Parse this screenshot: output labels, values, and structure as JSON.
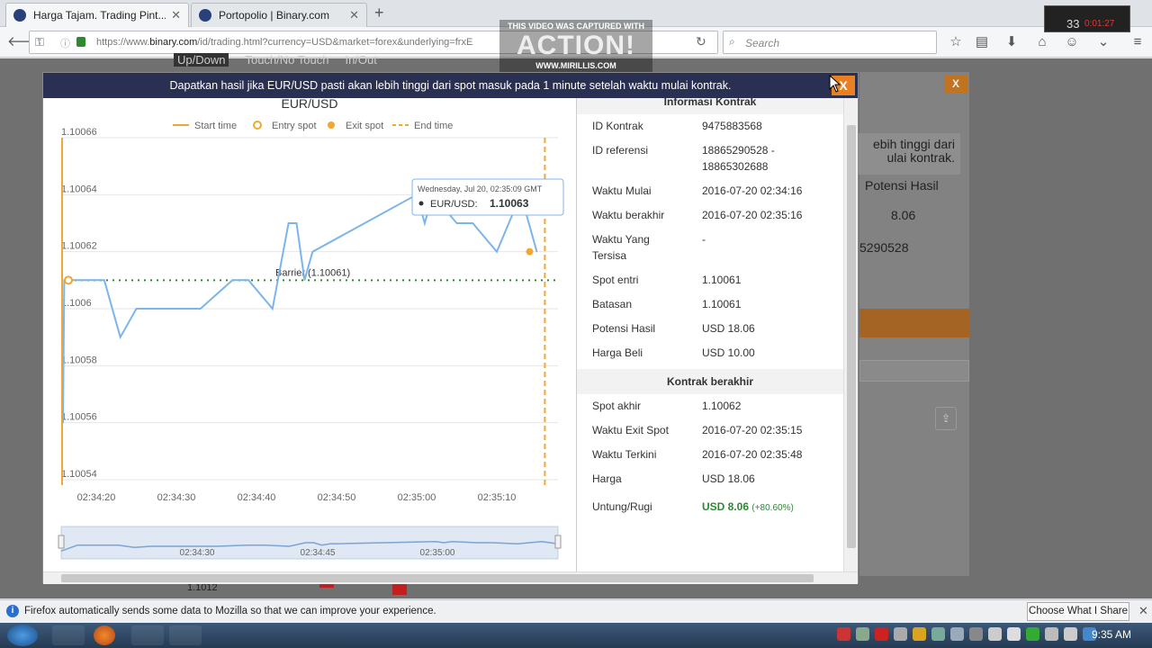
{
  "browser": {
    "tabs": [
      {
        "title": "Harga Tajam. Trading Pint...",
        "active": true
      },
      {
        "title": "Portopolio | Binary.com",
        "active": false
      }
    ],
    "url_prefix": "https://www.",
    "url_domain": "binary.com",
    "url_rest": "/id/trading.html?currency=USD&market=forex&underlying=frxE",
    "search_placeholder": "Search"
  },
  "watermark": {
    "line1": "THIS VIDEO WAS CAPTURED WITH",
    "line2": "ACTION!",
    "line3": "WWW.MIRILLIS.COM"
  },
  "recorder": {
    "value": "33",
    "time": "0:01:27"
  },
  "modal": {
    "header": "Dapatkan hasil jika EUR/USD pasti akan lebih tinggi dari spot masuk pada 1 minute setelah waktu mulai kontrak.",
    "close_label": "X",
    "info_title": "Informasi Kontrak",
    "rows": [
      {
        "k": "ID Kontrak",
        "v": "9475883568"
      },
      {
        "k": "ID referensi",
        "v": "18865290528 -\n18865302688"
      },
      {
        "k": "Waktu Mulai",
        "v": "2016-07-20 02:34:16"
      },
      {
        "k": "Waktu berakhir",
        "v": "2016-07-20 02:35:16"
      },
      {
        "k": "Waktu Yang\nTersisa",
        "v": "-"
      },
      {
        "k": "Spot entri",
        "v": "1.10061"
      },
      {
        "k": "Batasan",
        "v": "1.10061"
      },
      {
        "k": "Potensi Hasil",
        "v": "USD 18.06"
      },
      {
        "k": "Harga Beli",
        "v": "USD 10.00"
      }
    ],
    "ended_title": "Kontrak berakhir",
    "ended_rows": [
      {
        "k": "Spot akhir",
        "v": "1.10062"
      },
      {
        "k": "Waktu Exit Spot",
        "v": "2016-07-20 02:35:15"
      },
      {
        "k": "Waktu Terkini",
        "v": "2016-07-20 02:35:48"
      },
      {
        "k": "Harga",
        "v": "USD 18.06"
      }
    ],
    "profit_label": "Untung/Rugi",
    "profit_value": "USD 8.06",
    "profit_pct": "(+80.60%)"
  },
  "background": {
    "tabs": [
      "Up/Down",
      "Touch/No Touch",
      "In/Out"
    ],
    "close_label": "X",
    "desc": "ebih tinggi dari\nulai kontrak.",
    "potensi_label": "Potensi Hasil",
    "potensi_value": "8.06",
    "ref_value": "5290528",
    "bottom_value": "1.1012"
  },
  "chart_data": {
    "type": "line",
    "title": "EUR/USD",
    "legend": [
      "Start time",
      "Entry spot",
      "Exit spot",
      "End time"
    ],
    "x_ticks": [
      "02:34:20",
      "02:34:30",
      "02:34:40",
      "02:34:50",
      "02:35:00",
      "02:35:10"
    ],
    "y_ticks": [
      "1.10066",
      "1.10064",
      "1.10062",
      "1.1006",
      "1.10058",
      "1.10056",
      "1.10054"
    ],
    "ylim": [
      1.10054,
      1.10066
    ],
    "barrier_label": "Barrier (1.10061)",
    "barrier": 1.10061,
    "series": [
      {
        "name": "EUR/USD",
        "x": [
          "02:34:14",
          "02:34:16",
          "02:34:19",
          "02:34:21",
          "02:34:23",
          "02:34:25",
          "02:34:27",
          "02:34:33",
          "02:34:37",
          "02:34:39",
          "02:34:42",
          "02:34:44",
          "02:34:45",
          "02:34:46",
          "02:34:47",
          "02:35:00",
          "02:35:01",
          "02:35:02",
          "02:35:05",
          "02:35:07",
          "02:35:10",
          "02:35:13",
          "02:35:15"
        ],
        "y": [
          1.10056,
          1.10061,
          1.10061,
          1.10061,
          1.10059,
          1.1006,
          1.1006,
          1.1006,
          1.10061,
          1.10061,
          1.1006,
          1.10063,
          1.10063,
          1.10061,
          1.10062,
          1.10064,
          1.10063,
          1.10064,
          1.10063,
          1.10063,
          1.10062,
          1.10064,
          1.10062
        ]
      }
    ],
    "start_time": "02:34:16",
    "end_time": "02:35:16",
    "entry": {
      "x": "02:34:16",
      "y": 1.10061
    },
    "exit": {
      "x": "02:35:15",
      "y": 1.10062
    },
    "tooltip": {
      "line1": "Wednesday, Jul 20, 02:35:09 GMT",
      "label": "EUR/USD:",
      "value": "1.10063"
    },
    "navigator_ticks": [
      "02:34:30",
      "02:34:45",
      "02:35:00"
    ],
    "colors": {
      "line": "#7cb5ec",
      "accent": "#f0a830",
      "barrier": "#2e8a2e"
    }
  },
  "notification": {
    "text": "Firefox automatically sends some data to Mozilla so that we can improve your experience.",
    "button": "Choose What I Share"
  },
  "taskbar": {
    "clock": "9:35 AM"
  }
}
